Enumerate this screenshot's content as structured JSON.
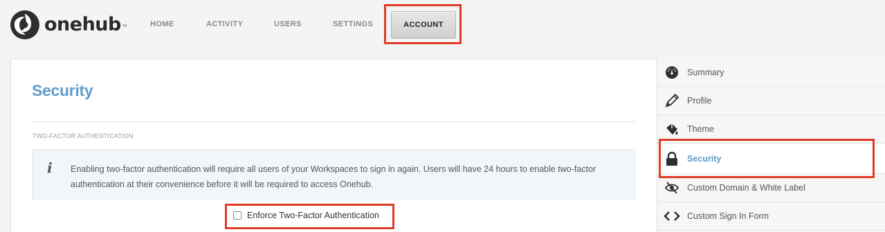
{
  "brand": {
    "name": "onehub",
    "tm": "™"
  },
  "nav": {
    "items": [
      {
        "label": "HOME"
      },
      {
        "label": "ACTIVITY"
      },
      {
        "label": "USERS"
      },
      {
        "label": "SETTINGS"
      },
      {
        "label": "ACCOUNT",
        "active": true
      }
    ]
  },
  "main": {
    "title": "Security",
    "section_label": "TWO-FACTOR AUTHENTICATION",
    "info": {
      "icon": "info-italic-i-icon",
      "text": "Enabling two-factor authentication will require all users of your Workspaces to sign in again. Users will have 24 hours to enable two-factor authentication at their convenience before it will be required to access Onehub."
    },
    "enforce": {
      "label": "Enforce Two-Factor Authentication",
      "checked": false
    }
  },
  "sidebar": {
    "items": [
      {
        "label": "Summary",
        "icon": "dashboard-gauge-icon"
      },
      {
        "label": "Profile",
        "icon": "pencil-icon"
      },
      {
        "label": "Theme",
        "icon": "paint-bucket-icon"
      },
      {
        "label": "Security",
        "icon": "lock-icon",
        "active": true
      },
      {
        "label": "Custom Domain & White Label",
        "icon": "hidden-eye-icon"
      },
      {
        "label": "Custom Sign In Form",
        "icon": "code-brackets-icon"
      }
    ]
  },
  "colors": {
    "accent": "#5e9cc9",
    "highlight": "#e23a26"
  }
}
